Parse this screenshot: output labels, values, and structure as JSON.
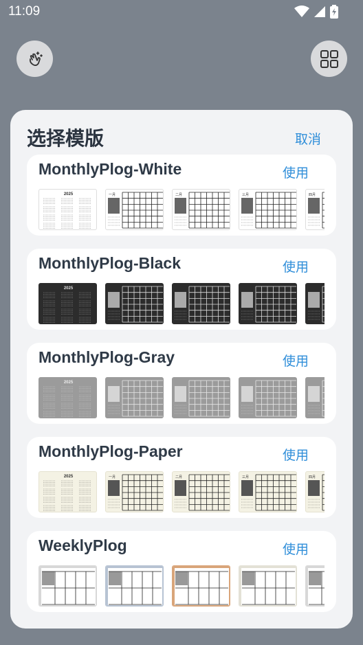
{
  "status_bar": {
    "time": "11:09"
  },
  "sheet": {
    "title": "选择模版",
    "cancel_label": "取消"
  },
  "templates": [
    {
      "name": "MonthlyPlog-White",
      "use_label": "使用",
      "year_label": "2025",
      "months": [
        "一月",
        "二月",
        "三月",
        "四月"
      ],
      "theme": "white"
    },
    {
      "name": "MonthlyPlog-Black",
      "use_label": "使用",
      "year_label": "2025",
      "theme": "black"
    },
    {
      "name": "MonthlyPlog-Gray",
      "use_label": "使用",
      "year_label": "2025",
      "theme": "gray"
    },
    {
      "name": "MonthlyPlog-Paper",
      "use_label": "使用",
      "year_label": "2025",
      "months": [
        "一月",
        "二月",
        "三月",
        "四月"
      ],
      "theme": "paper"
    },
    {
      "name": "WeeklyPlog",
      "use_label": "使用",
      "theme": "weekly"
    }
  ],
  "colors": {
    "backdrop": "#7b838d",
    "sheet": "#f2f3f5",
    "accent": "#2f8ed9",
    "title_text": "#2b3440"
  },
  "icons": [
    "wifi-icon",
    "signal-icon",
    "battery-charging-icon",
    "sparkle-hand-icon",
    "grid-icon"
  ]
}
